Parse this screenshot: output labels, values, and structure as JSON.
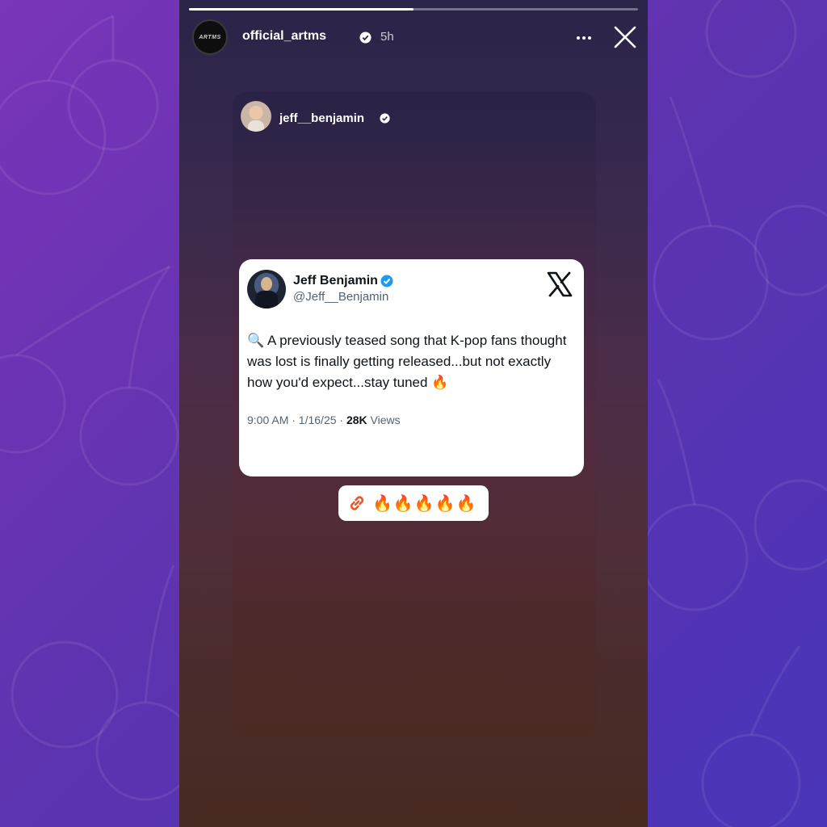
{
  "story": {
    "progress_fraction": 0.5,
    "header": {
      "avatar_text": "ARTMS",
      "username": "official_artms",
      "time": "5h"
    },
    "shared_post": {
      "username": "jeff__benjamin",
      "tweet": {
        "name": "Jeff Benjamin",
        "handle": "@Jeff__Benjamin",
        "icon_prefix": "🔍",
        "text": "A previously teased song that K-pop fans thought was lost is finally getting released...but not exactly how you'd expect...stay tuned 🔥",
        "meta_time": "9:00 AM · 1/16/25 · ",
        "views_count": "28K",
        "views_label": " Views"
      }
    },
    "link_sticker": {
      "text": "🔥🔥🔥🔥🔥"
    }
  },
  "colors": {
    "verified_blue": "#1d9bf0",
    "link_orange": "#e8572a"
  },
  "icons": [
    "verified-icon",
    "more-icon",
    "close-icon",
    "x-logo-icon",
    "link-icon",
    "magnifier-icon"
  ]
}
